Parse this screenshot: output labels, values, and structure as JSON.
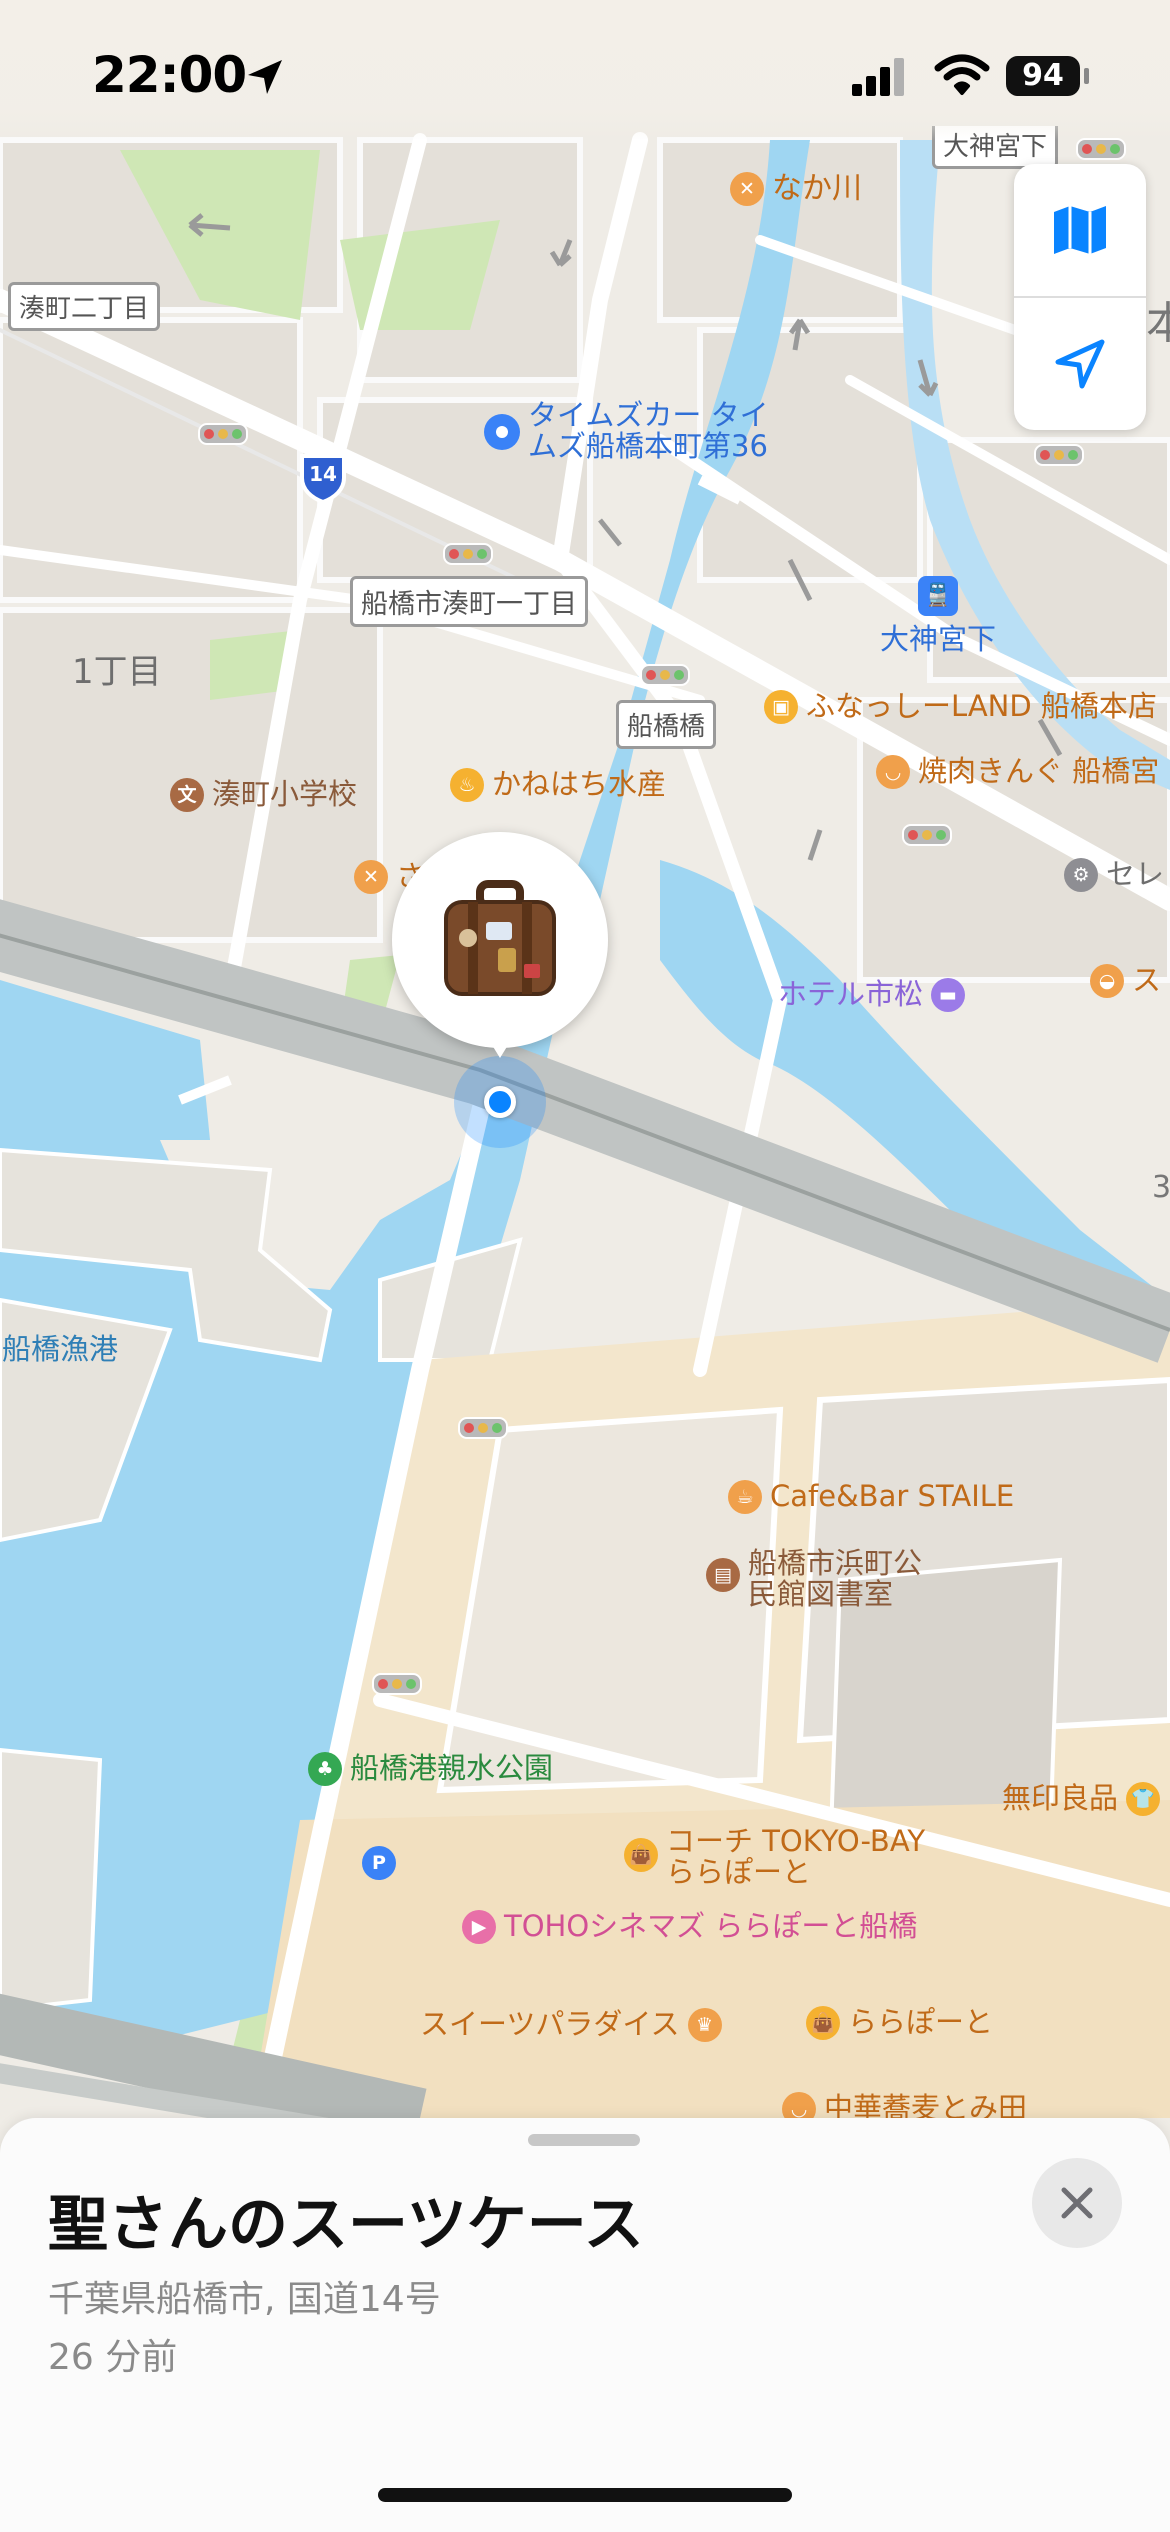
{
  "status_bar": {
    "time": "22:00",
    "battery": "94"
  },
  "map": {
    "place_labels": [
      {
        "key": "minatomachi_2",
        "text": "湊町二丁目"
      },
      {
        "key": "funabashi_minatomachi_1",
        "text": "船橋市湊町一丁目"
      },
      {
        "key": "funabashi_bridge",
        "text": "船橋橋"
      },
      {
        "key": "ogamimiya_top",
        "text": "大神宮下"
      },
      {
        "key": "chome_1",
        "text": "1丁目"
      },
      {
        "key": "gyoko",
        "text": "船橋漁港"
      },
      {
        "key": "hon_cut",
        "text": "本"
      },
      {
        "key": "num_3",
        "text": "3"
      }
    ],
    "route_shield": "14",
    "pois": [
      {
        "key": "nakagawa",
        "text": "なか川",
        "icon": "restaurant-icon",
        "color": "#f0a04b"
      },
      {
        "key": "times",
        "text": "タイムズカー タイ\nムズ船橋本町第36",
        "icon": "location-dot-icon",
        "color": "#3a82f7"
      },
      {
        "key": "station",
        "text": "大神宮下",
        "icon": "train-icon",
        "color": "#3a82f7"
      },
      {
        "key": "funasshi",
        "text": "ふなっしーLAND 船橋本店",
        "icon": "shopping-bag-icon",
        "color": "#f0a04b"
      },
      {
        "key": "yakiniku",
        "text": "焼肉きんぐ 船橋宮",
        "icon": "bowl-icon",
        "color": "#f0a04b"
      },
      {
        "key": "school",
        "text": "湊町小学校",
        "icon": "school-icon",
        "color": "#a86a44"
      },
      {
        "key": "kanehachi",
        "text": "かねはち水産",
        "icon": "basket-icon",
        "color": "#f5b130"
      },
      {
        "key": "sa",
        "text": "さ",
        "icon": "restaurant-icon",
        "color": "#f0a04b"
      },
      {
        "key": "sere",
        "text": "セレ",
        "icon": "service-icon",
        "color": "#8e8e93"
      },
      {
        "key": "hotel",
        "text": "ホテル市松",
        "icon": "bed-icon",
        "color": "#9b7be8"
      },
      {
        "key": "su",
        "text": "ス",
        "icon": "sushi-icon",
        "color": "#f0a04b"
      },
      {
        "key": "cafe",
        "text": "Cafe&Bar STAILE",
        "icon": "cup-icon",
        "color": "#f0a04b"
      },
      {
        "key": "library",
        "text": "船橋市浜町公\n民館図書室",
        "icon": "book-icon",
        "color": "#a86a44"
      },
      {
        "key": "muji",
        "text": "無印良品",
        "icon": "shirt-icon",
        "color": "#f5b130"
      },
      {
        "key": "park",
        "text": "船橋港親水公園",
        "icon": "tree-icon",
        "color": "#34a853"
      },
      {
        "key": "parking",
        "text": "P",
        "icon": "parking-icon",
        "color": "#3a82f7"
      },
      {
        "key": "coach",
        "text": "コーチ TOKYO-BAY\nららぽーと",
        "icon": "bag-icon",
        "color": "#f5b130"
      },
      {
        "key": "toho",
        "text": "TOHOシネマズ ららぽーと船橋",
        "icon": "film-icon",
        "color": "#e86fa8"
      },
      {
        "key": "sweets",
        "text": "スイーツパラダイス",
        "icon": "cake-icon",
        "color": "#f0a04b"
      },
      {
        "key": "lalaport",
        "text": "ららぽーと",
        "icon": "bag-icon",
        "color": "#f5b130"
      },
      {
        "key": "chuka",
        "text": "中華蕎麦とみ田",
        "icon": "bowl-icon",
        "color": "#f0a04b"
      }
    ],
    "item_pin": {
      "icon": "suitcase-icon"
    }
  },
  "map_controls": [
    {
      "key": "map_mode",
      "icon": "map-icon"
    },
    {
      "key": "locate",
      "icon": "location-arrow-icon"
    }
  ],
  "sheet": {
    "title": "聖さんのスーツケース",
    "address": "千葉県船橋市, 国道14号",
    "time_ago": "26 分前"
  },
  "colors": {
    "water": "#9fd6f2",
    "land": "#efece6",
    "park": "#cfe7b5",
    "accent": "#0a84ff"
  }
}
